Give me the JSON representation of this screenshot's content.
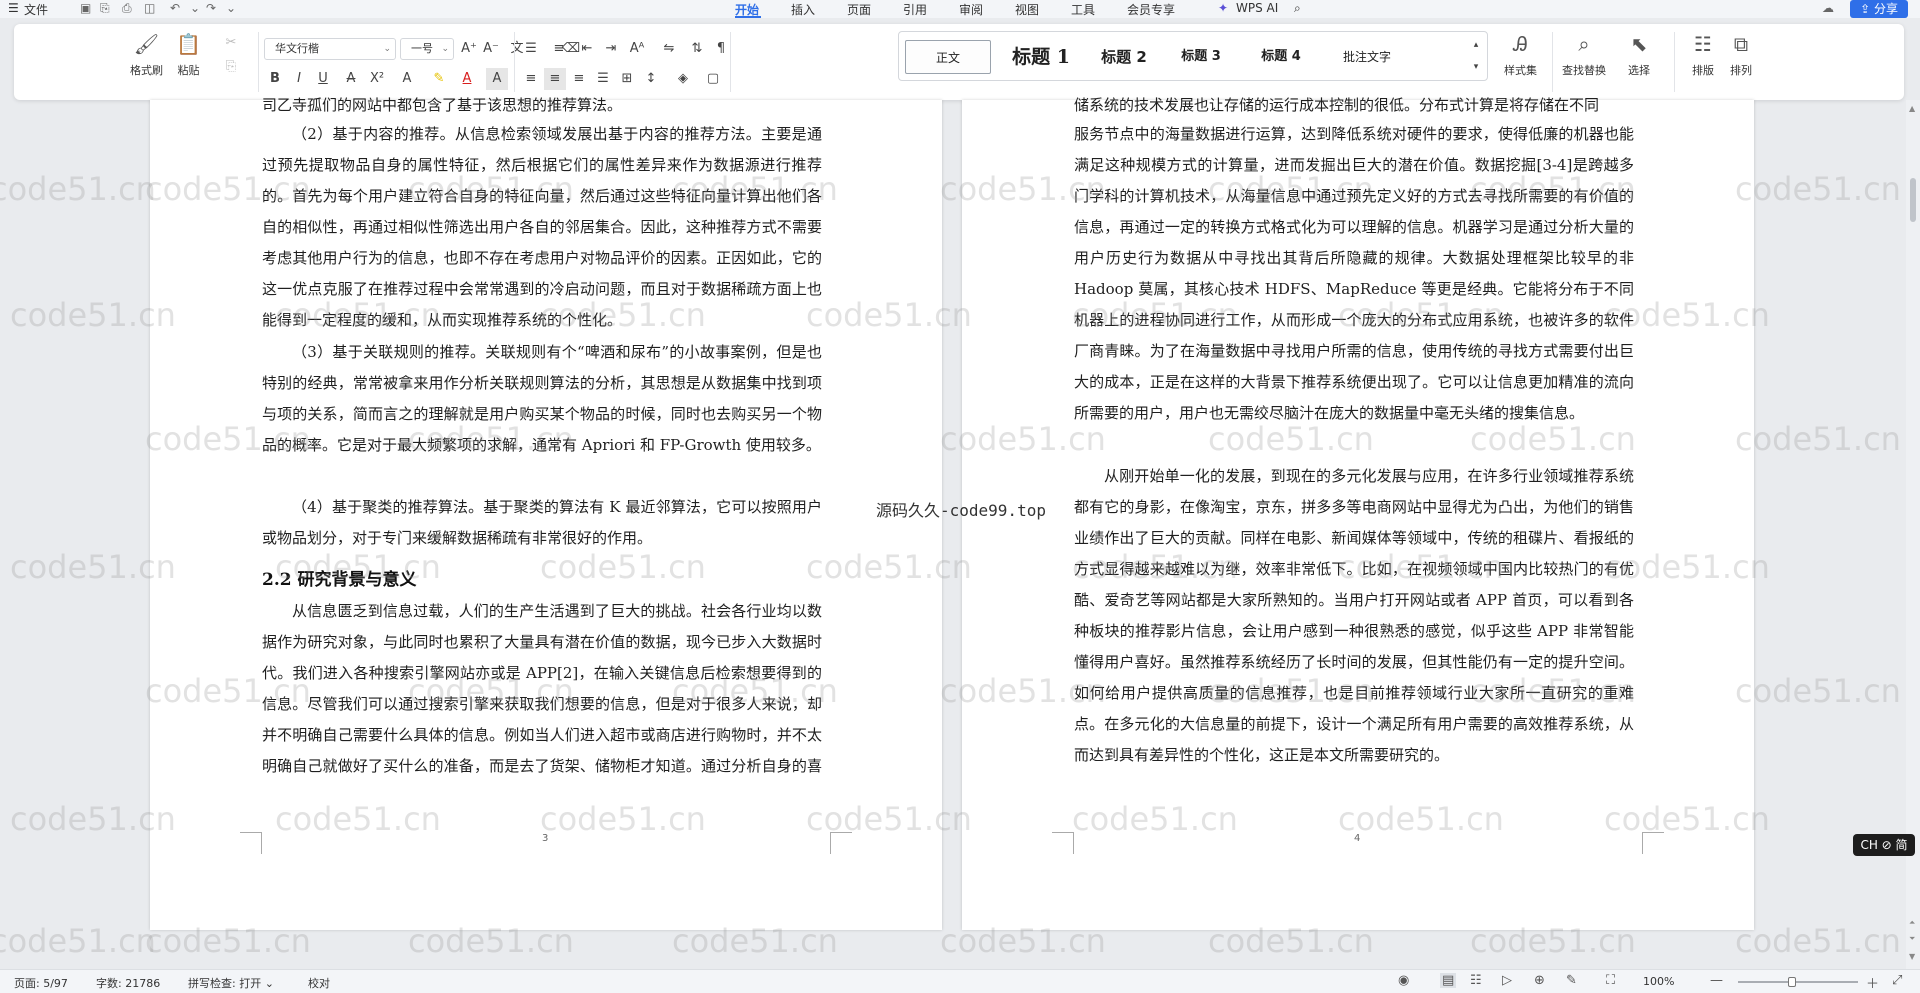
{
  "menubar": {
    "file": "文件",
    "tabs": [
      "开始",
      "插入",
      "页面",
      "引用",
      "审阅",
      "视图",
      "工具",
      "会员专享"
    ],
    "active_tab": "开始",
    "wps_ai": "WPS AI",
    "share": "分享"
  },
  "ribbon": {
    "format_painter": "格式刷",
    "paste": "粘贴",
    "font_name": "华文行楷",
    "font_size": "一号",
    "styles": [
      "正文",
      "标题 1",
      "标题 2",
      "标题 3",
      "标题 4",
      "批注文字"
    ],
    "style_set": "样式集",
    "find_replace": "查找替换",
    "select": "选择",
    "typeset": "排版",
    "arrange": "排列"
  },
  "page3": {
    "top_fragment": "司乙寺孤们的网站中都包含了基于该思想的推荐算法。",
    "para1": "（2）基于内容的推荐。从信息检索领域发展出基于内容的推荐方法。主要是通过预先提取物品自身的属性特征，然后根据它们的属性差异来作为数据源进行推荐的。首先为每个用户建立符合自身的特征向量，然后通过这些特征向量计算出他们各自的相似性，再通过相似性筛选出用户各自的邻居集合。因此，这种推荐方式不需要考虑其他用户行为的信息，也即不存在考虑用户对物品评价的因素。正因如此，它的这一优点克服了在推荐过程中会常常遇到的冷启动问题，而且对于数据稀疏方面上也能得到一定程度的缓和，从而实现推荐系统的个性化。",
    "para2": "（3）基于关联规则的推荐。关联规则有个“啤酒和尿布”的小故事案例，但是也特别的经典，常常被拿来用作分析关联规则算法的分析，其思想是从数据集中找到项与项的关系，简而言之的理解就是用户购买某个物品的时候，同时也去购买另一个物品的概率。它是对于最大频繁项的求解，通常有 Apriori 和 FP-Growth 使用较多。",
    "para3": "（4）基于聚类的推荐算法。基于聚类的算法有 K 最近邻算法，它可以按照用户或物品划分，对于专门来缓解数据稀疏有非常很好的作用。",
    "heading": "2.2  研究背景与意义",
    "para4": "从信息匮乏到信息过载，人们的生产生活遇到了巨大的挑战。社会各行业均以数据作为研究对象，与此同时也累积了大量具有潜在价值的数据，现今已步入大数据时代。我们进入各种搜索引擎网站亦或是 APP[2]，在输入关键信息后检索想要得到的信息。尽管我们可以通过搜索引擎来获取我们想要的信息，但是对于很多人来说，却并不明确自己需要什么具体的信息。例如当人们进入超市或商店进行购物时，并不太明确自己就做好了买什么的准备，而是去了货架、储物柜才知道。通过分析自身的喜好和需求，最终决定买什么。我们身处于一个信息爆",
    "page_number": "3"
  },
  "page4": {
    "top_fragment": "储系统的技术发展也让存储的运行成本控制的很低。分布式计算是将存储在不同",
    "para1": "服务节点中的海量数据进行运算，达到降低系统对硬件的要求，使得低廉的机器也能满足这种规模方式的计算量，进而发掘出巨大的潜在价值。数据挖掘[3-4]是跨越多门学科的计算机技术，从海量信息中通过预先定义好的方式去寻找所需要的有价值的信息，再通过一定的转换方式格式化为可以理解的信息。机器学习是通过分析大量的用户历史行为数据从中寻找出其背后所隐藏的规律。大数据处理框架比较早的非 Hadoop 莫属，其核心技术 HDFS、MapReduce 等更是经典。它能将分布于不同机器上的进程协同进行工作，从而形成一个庞大的分布式应用系统，也被许多的软件厂商青睐。为了在海量数据中寻找用户所需的信息，使用传统的寻找方式需要付出巨大的成本，正是在这样的大背景下推荐系统便出现了。它可以让信息更加精准的流向所需要的用户，用户也无需绞尽脑汁在庞大的数据量中毫无头绪的搜集信息。",
    "para2": "从刚开始单一化的发展，到现在的多元化发展与应用，在许多行业领域推荐系统都有它的身影，在像淘宝，京东，拼多多等电商网站中显得尤为凸出，为他们的销售业绩作出了巨大的贡献。同样在电影、新闻媒体等领域中，传统的租碟片、看报纸的方式显得越来越难以为继，效率非常低下。比如，在视频领域中国内比较热门的有优酷、爱奇艺等网站都是大家所熟知的。当用户打开网站或者 APP 首页，可以看到各种板块的推荐影片信息，会让用户感到一种很熟悉的感觉，似乎这些 APP 非常智能懂得用户喜好。虽然推荐系统经历了长时间的发展，但其性能仍有一定的提升空间。如何给用户提供高质量的信息推荐，也是目前推荐领域行业大家所一直研究的重难点。在多元化的大信息量的前提下，设计一个满足所有用户需要的高效推荐系统，从而达到具有差异性的个性化，这正是本文所需要研究的。",
    "page_number": "4"
  },
  "watermark": {
    "text": "code51.cn",
    "center_text": "源码久久-code99.top"
  },
  "ime": "CH ⊘ 简",
  "status": {
    "page": "页面: 5/97",
    "words": "字数: 21786",
    "spell": "拼写检查: 打开",
    "proof": "校对",
    "zoom": "100%",
    "zoom_fraction": 0.45
  }
}
